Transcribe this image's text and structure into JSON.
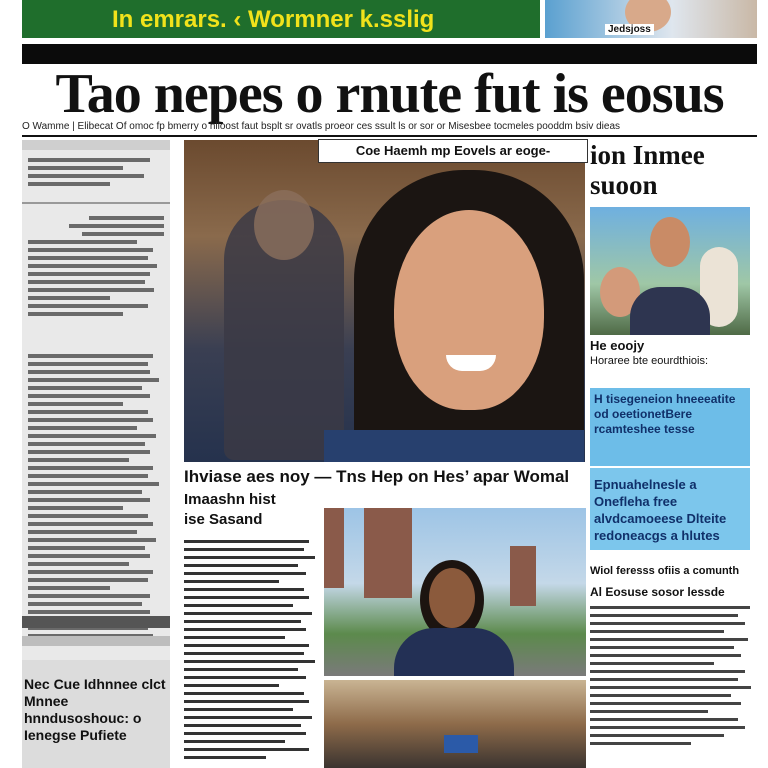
{
  "banner": {
    "title": "In emrars. ‹ Wormner k.sslig",
    "photo_caption": "Jedsjoss"
  },
  "headline": "Tao nepes o rnute fut is eosus",
  "dek": "O Wamme | Elibecat Of omoc fp bmerry o hlloost faut bsplt sr ovatls proeor ces ssult ls or sor or Misesbee tocmeles pooddm bsiv dieas",
  "main_photo": {
    "caption": "Coe Haemh mp Eovels ar eoge-"
  },
  "right_column": {
    "title": "ion Inmee\nsuoon",
    "story_heading": "He eoojy",
    "story_sub": "Horaree bte eourdthiois:",
    "blue_box_1": "H tisegeneion hneeeatite od oeetionetBere rcamteshee tesse",
    "blue_box_2": "Epnuahelnesle a Onefleha free alvdcamoeese Dlteite redoneacgs a hlutes",
    "lower_heading": "Wiol feresss ofiis a comunth",
    "lower_sub": "Al Eosuse sosor lessde"
  },
  "left_column": {
    "footer_title": "Nec Cue Idhnnee clct Mnnee hnndusoshouc: o Ienegse Pufiete"
  },
  "center": {
    "headline": "Ihviase aes noy — Tns Hep on Hes’ apar Womal",
    "subhead": "Imaashn hist\nise Sasand"
  }
}
